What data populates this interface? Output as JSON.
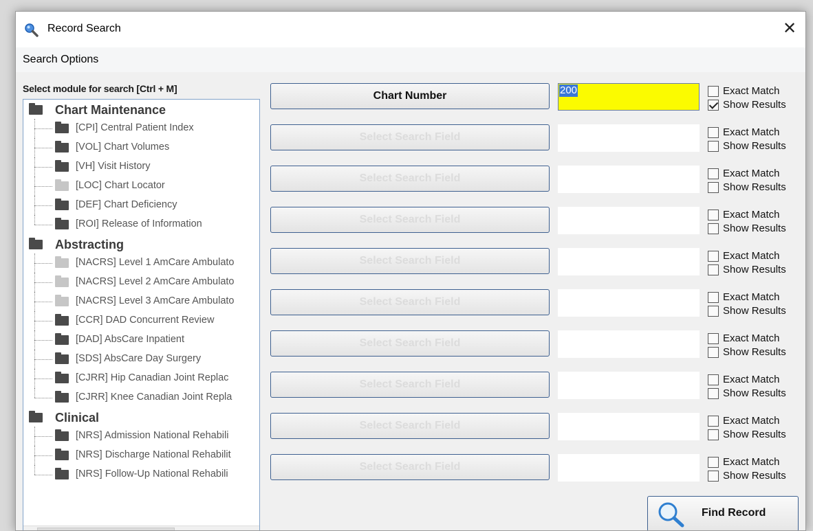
{
  "window": {
    "title": "Record Search",
    "close_glyph": "✕"
  },
  "menu": {
    "items": [
      "Search Options"
    ]
  },
  "module_panel": {
    "label": "Select module for search [Ctrl + M]",
    "groups": [
      {
        "name": "Chart Maintenance",
        "items": [
          {
            "label": "[CPI] Central Patient Index",
            "shade": "dark"
          },
          {
            "label": "[VOL] Chart Volumes",
            "shade": "dark"
          },
          {
            "label": "[VH] Visit History",
            "shade": "dark"
          },
          {
            "label": "[LOC] Chart Locator",
            "shade": "light"
          },
          {
            "label": "[DEF] Chart Deficiency",
            "shade": "dark"
          },
          {
            "label": "[ROI] Release of Information",
            "shade": "dark"
          }
        ]
      },
      {
        "name": "Abstracting",
        "items": [
          {
            "label": "[NACRS] Level 1 AmCare Ambulato",
            "shade": "light"
          },
          {
            "label": "[NACRS] Level 2 AmCare Ambulato",
            "shade": "light"
          },
          {
            "label": "[NACRS] Level 3 AmCare Ambulato",
            "shade": "light"
          },
          {
            "label": "[CCR] DAD Concurrent Review",
            "shade": "dark"
          },
          {
            "label": "[DAD] AbsCare Inpatient",
            "shade": "dark"
          },
          {
            "label": "[SDS] AbsCare Day Surgery",
            "shade": "dark"
          },
          {
            "label": "[CJRR] Hip Canadian Joint Replac",
            "shade": "dark"
          },
          {
            "label": "[CJRR] Knee Canadian Joint Repla",
            "shade": "dark"
          }
        ]
      },
      {
        "name": "Clinical",
        "items": [
          {
            "label": "[NRS] Admission National Rehabili",
            "shade": "dark"
          },
          {
            "label": "[NRS] Discharge National Rehabilit",
            "shade": "dark"
          },
          {
            "label": "[NRS] Follow-Up National Rehabili",
            "shade": "dark"
          }
        ]
      }
    ],
    "scroll_left": "<",
    "scroll_right": ">"
  },
  "search_rows": [
    {
      "field": "Chart Number",
      "value": "200",
      "active": true,
      "exact_match": false,
      "show_results": true
    },
    {
      "field": "Select Search Field",
      "value": "",
      "active": false,
      "exact_match": false,
      "show_results": false
    },
    {
      "field": "Select Search Field",
      "value": "",
      "active": false,
      "exact_match": false,
      "show_results": false
    },
    {
      "field": "Select Search Field",
      "value": "",
      "active": false,
      "exact_match": false,
      "show_results": false
    },
    {
      "field": "Select Search Field",
      "value": "",
      "active": false,
      "exact_match": false,
      "show_results": false
    },
    {
      "field": "Select Search Field",
      "value": "",
      "active": false,
      "exact_match": false,
      "show_results": false
    },
    {
      "field": "Select Search Field",
      "value": "",
      "active": false,
      "exact_match": false,
      "show_results": false
    },
    {
      "field": "Select Search Field",
      "value": "",
      "active": false,
      "exact_match": false,
      "show_results": false
    },
    {
      "field": "Select Search Field",
      "value": "",
      "active": false,
      "exact_match": false,
      "show_results": false
    },
    {
      "field": "Select Search Field",
      "value": "",
      "active": false,
      "exact_match": false,
      "show_results": false
    }
  ],
  "labels": {
    "exact_match": "Exact Match",
    "show_results": "Show Results"
  },
  "find_button": {
    "label": "Find Record",
    "icon": "magnifier-icon"
  },
  "colors": {
    "highlight_field": "#fbfb00",
    "selection": "#3a78d6",
    "button_border": "#3d5f8f"
  }
}
